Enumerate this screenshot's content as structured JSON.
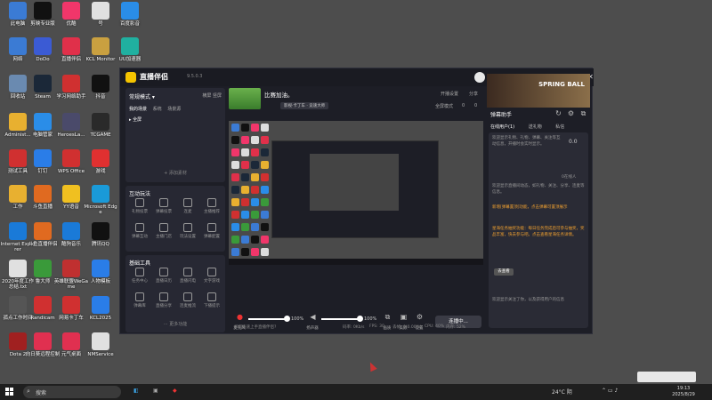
{
  "desktop": {
    "icons": [
      {
        "label": "此电脑",
        "color": "#3b7bd4"
      },
      {
        "label": "剪映专业版",
        "color": "#111111"
      },
      {
        "label": "优酷",
        "color": "#f0366a"
      },
      {
        "label": "号",
        "color": "#e0e0e0"
      },
      {
        "label": "百度影音",
        "color": "#2a8de8"
      },
      {
        "label": "网络",
        "color": "#3b7bd4"
      },
      {
        "label": "DoDo",
        "color": "#3b5bd4"
      },
      {
        "label": "直播伴侣",
        "color": "#e0304a"
      },
      {
        "label": "KCL Monitor",
        "color": "#c9a040"
      },
      {
        "label": "UU加速器",
        "color": "#20b0a0"
      },
      {
        "label": "回收站",
        "color": "#6a8ab0"
      },
      {
        "label": "Steam",
        "color": "#1b2838"
      },
      {
        "label": "学习网络助手",
        "color": "#d03030"
      },
      {
        "label": "抖音",
        "color": "#111111"
      },
      {
        "label": "Administ...",
        "color": "#e8b030"
      },
      {
        "label": "电脑管家",
        "color": "#2a8de8"
      },
      {
        "label": "HeroesLa...",
        "color": "#4a4a6a"
      },
      {
        "label": "TCGAME",
        "color": "#2a2a2a"
      },
      {
        "label": "测试工具",
        "color": "#d03030"
      },
      {
        "label": "钉钉",
        "color": "#2a7de8"
      },
      {
        "label": "WPS Office",
        "color": "#d03030"
      },
      {
        "label": "游戏",
        "color": "#e03030"
      },
      {
        "label": "工作",
        "color": "#e8b030"
      },
      {
        "label": "斗鱼直播",
        "color": "#e06a20"
      },
      {
        "label": "YY语音",
        "color": "#f0c020"
      },
      {
        "label": "Microsoft Edge",
        "color": "#1a9ad8"
      },
      {
        "label": "Internet Explorer",
        "color": "#1a7ad8"
      },
      {
        "label": "斗鱼直播伴侣",
        "color": "#e06a20"
      },
      {
        "label": "酷狗音乐",
        "color": "#1a7ad8"
      },
      {
        "label": "腾讯QQ",
        "color": "#111111"
      },
      {
        "label": "2020年度工作总结.txt",
        "color": "#e0e0e0"
      },
      {
        "label": "鲁大师",
        "color": "#3a9a3a"
      },
      {
        "label": "英雄联盟WeGame",
        "color": "#c03030"
      },
      {
        "label": "人物模板",
        "color": "#2a7de8"
      },
      {
        "label": "孤点工作时间",
        "color": "#555555"
      },
      {
        "label": "Randicam",
        "color": "#d03030"
      },
      {
        "label": "网易卡丁车",
        "color": "#d03030"
      },
      {
        "label": "KCL2025",
        "color": "#2a7de8"
      },
      {
        "label": "Dota 2",
        "color": "#a02020"
      },
      {
        "label": "向日葵远程控制",
        "color": "#e03050"
      },
      {
        "label": "元气桌面",
        "color": "#e03050"
      },
      {
        "label": "NMService",
        "color": "#e0e0e0"
      }
    ]
  },
  "app": {
    "title": "直播伴侣",
    "version": "9.5.0.3",
    "left": {
      "mode": "常规模式 ▾",
      "mode_right": "横屏  竖屏",
      "tabs": [
        "我的场景",
        "系统",
        "场景源"
      ],
      "scene_item": "▸ 全屏",
      "add_source": "+ 添加素材",
      "interact_title": "互动玩法",
      "interact_items": [
        "礼物投票",
        "弹幕投票",
        "连麦",
        "主播推荐",
        "弹幕互动",
        "主播门店",
        "玩法设置",
        "弹幕配置"
      ],
      "tools_title": "基础工具",
      "tools_items": [
        "任务中心",
        "直播日历",
        "直播闪电",
        "文字游戏",
        "弹幕库",
        "直播分享",
        "连麦推流",
        "下播提示"
      ],
      "more": "⋯ 更多功能"
    },
    "center": {
      "stream_title": "比赛加油。",
      "category": "影视·卡丁车 · 竞速大师",
      "links": [
        "开播设置",
        "分享"
      ],
      "stats": [
        "全屏模式",
        "0",
        "0"
      ],
      "controls": {
        "mic_label": "麦克风",
        "mic_pct": "100%",
        "speaker_label": "扬声器",
        "speaker_pct": "100%",
        "btn1": "画质",
        "btn2": "美颜",
        "btn3": "设置"
      },
      "live_button": "连播中..."
    },
    "status": {
      "hint": "如何快速上手直播伴侣?",
      "items": [
        "码率: 0Kb/s",
        "FPS: 30",
        "丢帧: 0(0.00%)",
        "CPU: 40%",
        "内存: 52%"
      ]
    },
    "right": {
      "ad_text": "SPRING BALL",
      "title": "弹幕助手",
      "tabs": [
        "在线用户(1)",
        "送礼物",
        "私信"
      ],
      "text1": "欢迎显示礼物、礼物、弹幕、关注等互动信息，开播时会实时显示。",
      "number": "0.0",
      "badge": "0在线人",
      "text2": "欢迎显示直播间动态，如礼物、关注、分享、连麦等信息。",
      "hl1": "新增[弹幕置顶]功能，点击弹幕可置顶展示",
      "hl2": "星海任务抽奖功能：每日任务完成后可参与抽奖，奖品丰富，快去参与吧。点击查看星海任务详情。",
      "btn": "去查看",
      "text3": "欢迎显示关注了你，以及获得用户的信息"
    }
  },
  "taskbar": {
    "search": "搜索",
    "weather": "24°C 阴",
    "time": "19:13",
    "date": "2025/8/29"
  }
}
